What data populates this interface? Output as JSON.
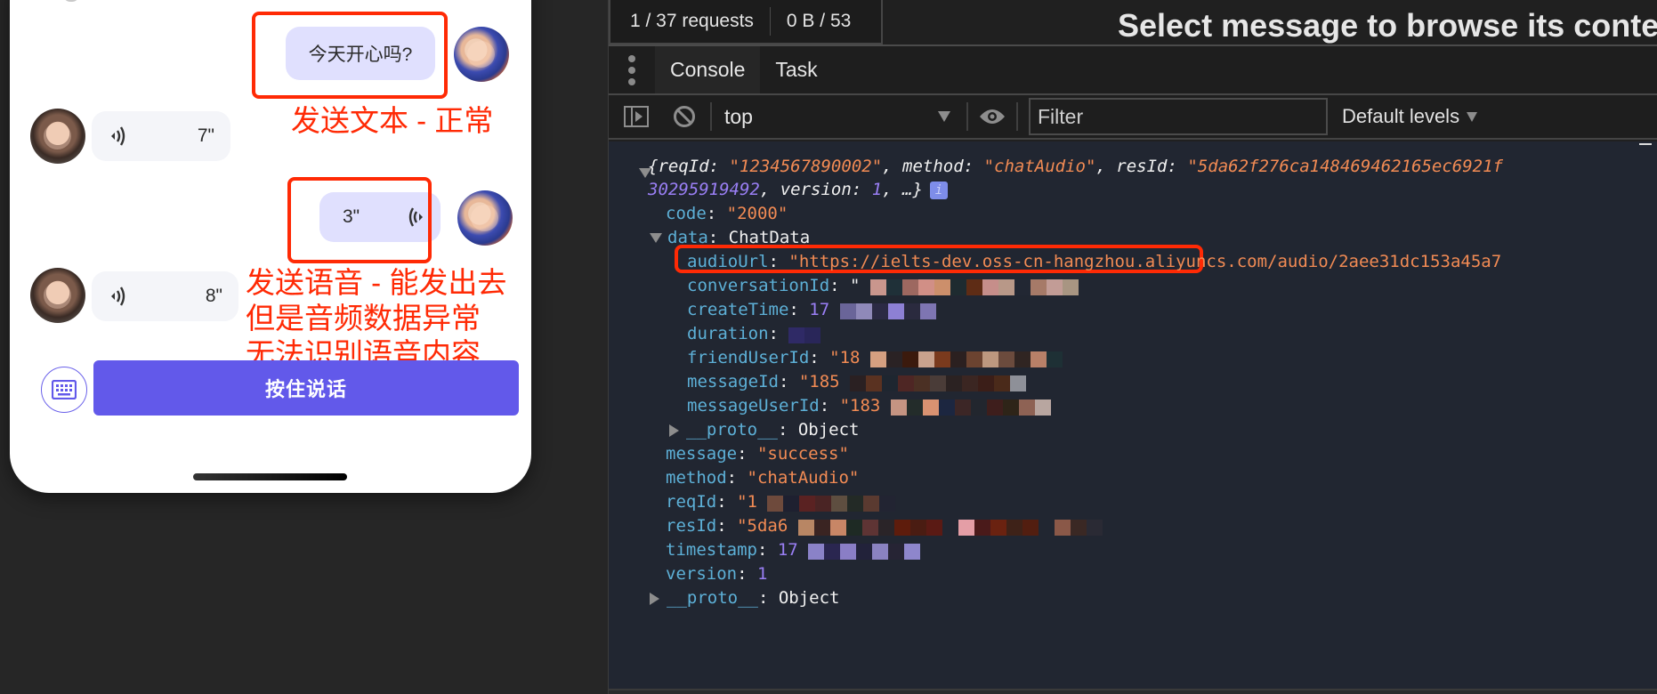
{
  "phone": {
    "messages": [
      {
        "side": "outgoing",
        "type": "text",
        "text": "今天开心吗?",
        "avatar": "boy-avatar"
      },
      {
        "side": "incoming",
        "type": "voice",
        "duration": "7\"",
        "avatar": "girl-avatar"
      },
      {
        "side": "outgoing",
        "type": "voice",
        "duration": "3\"",
        "avatar": "boy-avatar"
      },
      {
        "side": "incoming",
        "type": "voice",
        "duration": "8\"",
        "avatar": "girl-avatar"
      }
    ],
    "annotations": {
      "text_note": "发送文本 - 正常",
      "voice_note_lines": [
        "发送语音 - 能发出去",
        "但是音频数据异常",
        "无法识别语音内容"
      ],
      "annotation_color": "#ff2a05"
    },
    "input_bar": {
      "keyboard_icon": "keyboard-icon",
      "talk_button_label": "按住说话",
      "accent_color": "#6259ea"
    }
  },
  "devtools": {
    "network_summary": {
      "requests": "1 / 37 requests",
      "transferred": "0 B / 53"
    },
    "message_panel_hint": "Select message to browse its conte",
    "drawer_tabs": [
      {
        "label": "Console",
        "active": true
      },
      {
        "label": "Task",
        "active": false
      }
    ],
    "toolbar": {
      "context": "top",
      "filter_placeholder": "Filter",
      "levels": "Default levels"
    },
    "console": {
      "summary_line1": {
        "open": "{",
        "reqId_key": "reqId",
        "reqId_val": "\"1234567890002\"",
        "method_key": "method",
        "method_val": "\"chatAudio\"",
        "resId_key": "resId",
        "resId_val": "\"5da62f276ca148469462165ec6921f"
      },
      "summary_line2": {
        "cont": "30295919492",
        "version_key": "version",
        "version_val": "1",
        "tail": ", …}",
        "info": "i"
      },
      "code": {
        "key": "code",
        "value": "\"2000\""
      },
      "data": {
        "key": "data",
        "type": "ChatData"
      },
      "data_fields": [
        {
          "key": "audioUrl",
          "prefix": "\"https://ielts-dev.oss-cn-hangzhou.aliyuncs.com/audio/2aee31dc153a45a7",
          "kind": "string",
          "redacted": false
        },
        {
          "key": "conversationId",
          "prefix": "\"",
          "kind": "string",
          "redacted": true
        },
        {
          "key": "createTime",
          "prefix": "17",
          "kind": "number",
          "redacted": true
        },
        {
          "key": "duration",
          "prefix": "",
          "kind": "number",
          "redacted": true
        },
        {
          "key": "friendUserId",
          "prefix": "\"18",
          "kind": "string",
          "redacted": true
        },
        {
          "key": "messageId",
          "prefix": "\"185",
          "kind": "string",
          "redacted": true
        },
        {
          "key": "messageUserId",
          "prefix": "\"183",
          "kind": "string",
          "redacted": true
        }
      ],
      "inner_proto": {
        "key": "__proto__",
        "value": "Object"
      },
      "message": {
        "key": "message",
        "value": "\"success\""
      },
      "method": {
        "key": "method",
        "value": "\"chatAudio\""
      },
      "reqId": {
        "key": "reqId",
        "value": "\"1"
      },
      "resId": {
        "key": "resId",
        "value": "\"5da6"
      },
      "timestamp": {
        "key": "timestamp",
        "value": "17"
      },
      "version": {
        "key": "version",
        "value": "1"
      },
      "outer_proto": {
        "key": "__proto__",
        "value": "Object"
      }
    }
  }
}
